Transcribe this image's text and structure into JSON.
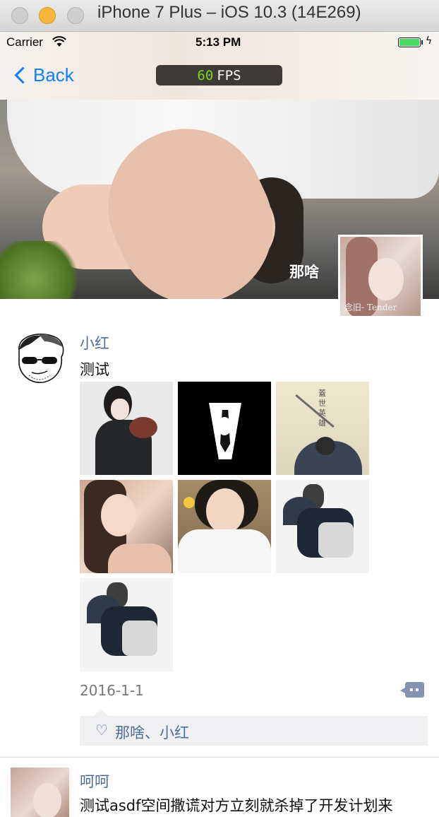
{
  "window": {
    "title": "iPhone 7 Plus – iOS 10.3 (14E269)"
  },
  "status_bar": {
    "carrier": "Carrier",
    "time": "5:13 PM",
    "wifi_icon": "wifi-icon",
    "battery_icon": "battery-icon"
  },
  "nav": {
    "back_label": "Back",
    "fps_value": "60",
    "fps_unit": "FPS"
  },
  "cover": {
    "name": "那啥",
    "avatar_watermark": "念旧-    Tender"
  },
  "feed": [
    {
      "name": "小红",
      "text": "测试",
      "date": "2016-1-1",
      "likes": "那啥、小红"
    },
    {
      "name": "呵呵",
      "text": "测试asdf空间撒谎对方立刻就杀掉了开发计划来"
    }
  ],
  "colors": {
    "link_blue": "#4f6e96",
    "ios_tint": "#147efb",
    "fps_green": "#7ed321"
  }
}
